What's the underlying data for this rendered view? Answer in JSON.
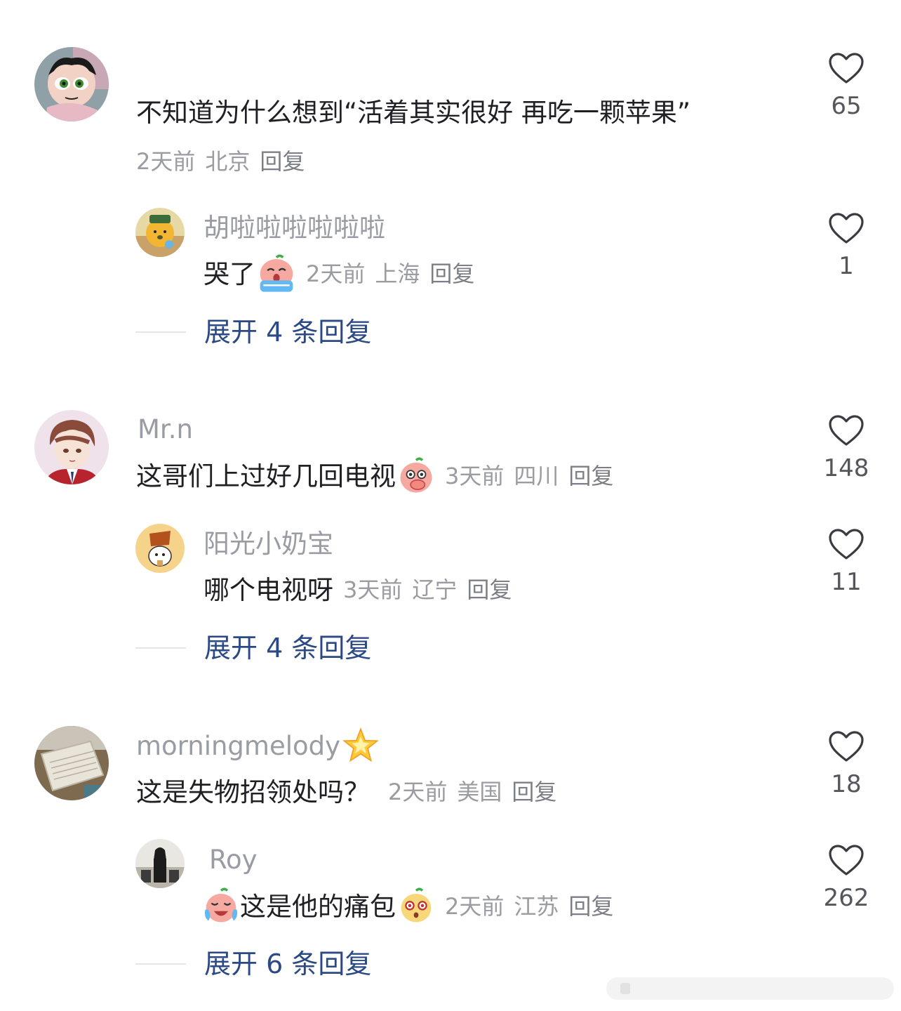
{
  "comments": [
    {
      "user": "",
      "text": "不知道为什么想到“活着其实很好 再吃一颗苹果”",
      "time": "2天前",
      "location": "北京",
      "reply_label": "回复",
      "likes": "65",
      "replies": [
        {
          "user": "胡啦啦啦啦啦啦",
          "text": "哭了",
          "emoji": "crying-emoji",
          "time": "2天前",
          "location": "上海",
          "reply_label": "回复",
          "likes": "1"
        }
      ],
      "expand_label": "展开 4 条回复"
    },
    {
      "user": "Mr.n",
      "text": "这哥们上过好几回电视",
      "emoji": "covering-mouth-emoji",
      "time": "3天前",
      "location": "四川",
      "reply_label": "回复",
      "likes": "148",
      "replies": [
        {
          "user": "阳光小奶宝",
          "text": "哪个电视呀",
          "time": "3天前",
          "location": "辽宁",
          "reply_label": "回复",
          "likes": "11"
        }
      ],
      "expand_label": "展开 4 条回复"
    },
    {
      "user": "morningmelody",
      "user_badge": "star-icon",
      "text": "这是失物招领处吗？",
      "time": "2天前",
      "location": "美国",
      "reply_label": "回复",
      "likes": "18",
      "replies": [
        {
          "user": "Roy",
          "text": "这是他的痛包",
          "emoji_before": "laughing-crying-emoji",
          "emoji_after": "shocked-emoji",
          "time": "2天前",
          "location": "江苏",
          "reply_label": "回复",
          "likes": "262"
        }
      ],
      "expand_label": "展开 6 条回复"
    }
  ],
  "colors": {
    "expand_link": "#2b4a85",
    "meta_text": "#9b9ca1",
    "username": "#9a9ca3"
  }
}
